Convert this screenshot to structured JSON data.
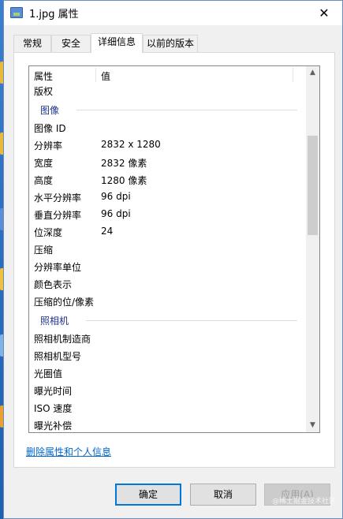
{
  "window": {
    "title": "1.jpg 属性",
    "close_glyph": "✕"
  },
  "tabs": [
    {
      "label": "常规"
    },
    {
      "label": "安全"
    },
    {
      "label": "详细信息"
    },
    {
      "label": "以前的版本"
    }
  ],
  "list": {
    "header": {
      "property": "属性",
      "value": "值"
    },
    "rows": {
      "copyright": {
        "k": "版权",
        "v": ""
      },
      "group_image": "图像",
      "image_id": {
        "k": "图像 ID",
        "v": ""
      },
      "resolution": {
        "k": "分辨率",
        "v": "2832 x 1280"
      },
      "width": {
        "k": "宽度",
        "v": "2832 像素"
      },
      "height": {
        "k": "高度",
        "v": "1280 像素"
      },
      "hres": {
        "k": "水平分辨率",
        "v": "96 dpi"
      },
      "vres": {
        "k": "垂直分辨率",
        "v": "96 dpi"
      },
      "bitdepth": {
        "k": "位深度",
        "v": "24"
      },
      "compression": {
        "k": "压缩",
        "v": ""
      },
      "resunit": {
        "k": "分辨率单位",
        "v": ""
      },
      "colorrep": {
        "k": "颜色表示",
        "v": ""
      },
      "compbits": {
        "k": "压缩的位/像素",
        "v": ""
      },
      "group_camera": "照相机",
      "maker": {
        "k": "照相机制造商",
        "v": ""
      },
      "model": {
        "k": "照相机型号",
        "v": ""
      },
      "fstop": {
        "k": "光圈值",
        "v": ""
      },
      "exposure": {
        "k": "曝光时间",
        "v": ""
      },
      "iso": {
        "k": "ISO 速度",
        "v": ""
      },
      "expcomp": {
        "k": "曝光补偿",
        "v": ""
      }
    }
  },
  "remove_link": "删除属性和个人信息",
  "buttons": {
    "ok": "确定",
    "cancel": "取消",
    "apply": "应用(A)"
  },
  "watermark": "@稀土掘金技术社区",
  "colors": {
    "link": "#0066cc",
    "group_header": "#1e3287",
    "primary_border": "#0078d7"
  }
}
